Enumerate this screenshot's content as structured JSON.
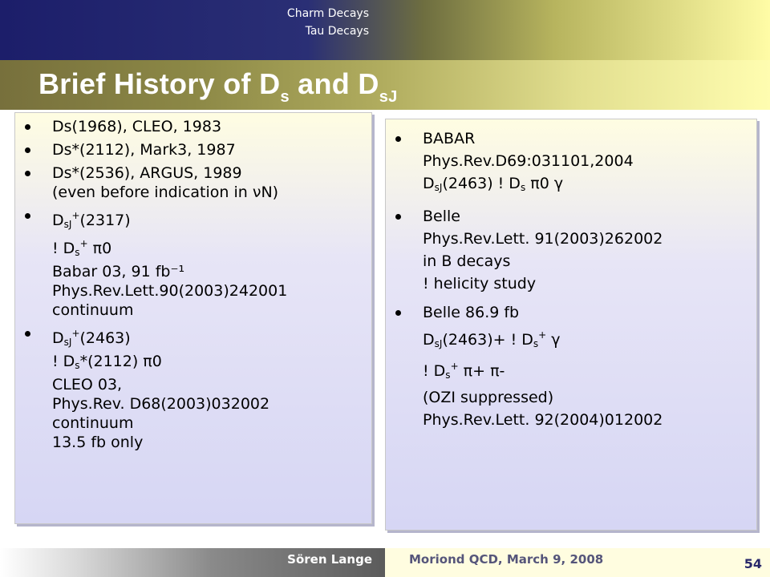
{
  "header": {
    "nav_items": [
      "Charm Decays",
      "Tau Decays"
    ],
    "title": "Brief History of D",
    "title_sub1": "s",
    "title_and": " and D",
    "title_sub2": "sJ"
  },
  "left_panel": {
    "items": [
      {
        "lines": [
          "Ds(1968), CLEO, 1983"
        ]
      },
      {
        "lines": [
          "Ds*(2112), Mark3, 1987"
        ]
      },
      {
        "lines": [
          "Ds*(2536), ARGUS, 1989",
          "(even before indication in νN)"
        ]
      },
      {
        "lines": [
          "D_sJ+(2317)",
          "! D_s+ π0",
          "Babar 03, 91 fb⁻¹",
          "Phys.Rev.Lett.90(2003)242001",
          "continuum"
        ]
      },
      {
        "lines": [
          "D_sJ+(2463)",
          "! D_s*(2112) π0",
          "CLEO 03,",
          "Phys.Rev. D68(2003)032002",
          "continuum",
          "13.5 fb only"
        ]
      }
    ]
  },
  "right_panel": {
    "items": [
      {
        "lines": [
          "BABAR",
          "Phys.Rev.D69:031101,2004",
          "D_sJ(2463) ! D_s π0 γ"
        ]
      },
      {
        "lines": [
          "Belle",
          "Phys.Rev.Lett. 91(2003)262002",
          "in B decays",
          "! helicity study"
        ]
      },
      {
        "lines": [
          "Belle 86.9 fb",
          "D_sJ(2463)+ ! D_s+ γ",
          "! D_s+ π+ π-",
          "(OZI suppressed)",
          "Phys.Rev.Lett. 92(2004)012002"
        ]
      }
    ]
  },
  "footer": {
    "author": "Sören Lange",
    "conference": "Moriond QCD, March 9, 2008",
    "page_number": "54"
  }
}
